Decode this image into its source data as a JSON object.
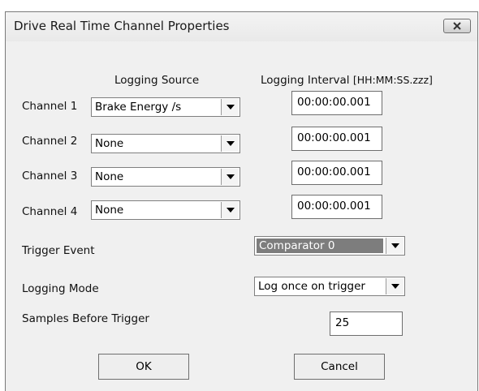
{
  "window": {
    "title": "Drive Real Time Channel Properties"
  },
  "headers": {
    "source": "Logging Source",
    "interval": "Logging Interval",
    "interval_format": "[HH:MM:SS.zzz]"
  },
  "channels": [
    {
      "label": "Channel 1",
      "source": "Brake Energy /s",
      "interval": "00:00:00.001"
    },
    {
      "label": "Channel 2",
      "source": "None",
      "interval": "00:00:00.001"
    },
    {
      "label": "Channel 3",
      "source": "None",
      "interval": "00:00:00.001"
    },
    {
      "label": "Channel 4",
      "source": "None",
      "interval": "00:00:00.001"
    }
  ],
  "trigger": {
    "label": "Trigger Event",
    "value": "Comparator 0"
  },
  "mode": {
    "label": "Logging Mode",
    "value": "Log once on trigger"
  },
  "samples": {
    "label": "Samples Before Trigger",
    "value": "25"
  },
  "buttons": {
    "ok": "OK",
    "cancel": "Cancel"
  },
  "icons": {
    "close": "close-icon",
    "dropdown": "chevron-down-icon"
  }
}
